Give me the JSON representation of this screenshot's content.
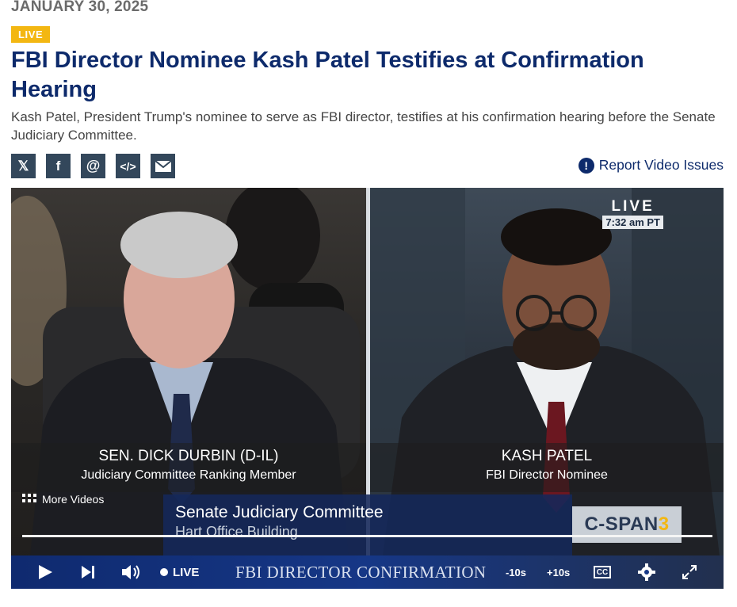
{
  "header": {
    "date": "JANUARY 30, 2025",
    "live_badge": "LIVE",
    "title": "FBI Director Nominee Kash Patel Testifies at Confirmation Hearing",
    "description": "Kash Patel, President Trump's nominee to serve as FBI director, testifies at his confirmation hearing before the Senate Judiciary Committee."
  },
  "share": {
    "icons": [
      "x-icon",
      "facebook-icon",
      "threads-icon",
      "embed-icon",
      "email-icon"
    ]
  },
  "report": {
    "label": "Report Video Issues"
  },
  "video": {
    "left_name": "SEN. DICK DURBIN (D-IL)",
    "left_role": "Judiciary Committee Ranking Member",
    "right_name": "KASH PATEL",
    "right_role": "FBI Director Nominee",
    "live_label": "LIVE",
    "live_time": "7:32 am PT",
    "more_videos": "More Videos",
    "banner_line1": "Senate Judiciary Committee",
    "banner_line2": "Hart Office Building",
    "network_logo_text": "C-SPAN",
    "network_logo_number": "3"
  },
  "controls": {
    "live": "LIVE",
    "show_title": "FBI DIRECTOR CONFIRMATION",
    "rewind": "-10s",
    "forward": "+10s",
    "cc": "CC",
    "progress_fraction": 1.0
  },
  "colors": {
    "title": "#0d2a6b",
    "live_badge": "#f3b712",
    "share_bg": "#33475b",
    "controls_bg": "#163786"
  }
}
